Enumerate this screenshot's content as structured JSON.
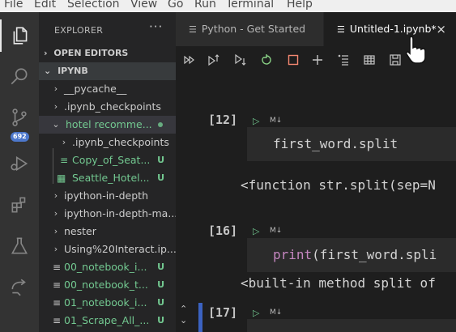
{
  "menu": [
    "File",
    "Edit",
    "Selection",
    "View",
    "Go",
    "Run",
    "Terminal",
    "Help"
  ],
  "activity_bar": {
    "items": [
      "explorer-icon",
      "search-icon",
      "source-control-icon",
      "run-debug-icon",
      "extensions-icon",
      "testing-icon",
      "remote-explorer-icon"
    ],
    "scm_badge": "692"
  },
  "sidebar": {
    "title": "EXPLORER",
    "more": "···",
    "open_editors": "OPEN EDITORS",
    "root": "IPYNB",
    "items": [
      {
        "label": "__pycache__",
        "status": ""
      },
      {
        "label": ".ipynb_checkpoints",
        "status": ""
      },
      {
        "label": "hotel recomme...",
        "status": "dot"
      },
      {
        "label": ".ipynb_checkpoints",
        "status": ""
      },
      {
        "label": "Copy_of_Seat...",
        "status": "U"
      },
      {
        "label": "Seattle_Hotel...",
        "status": "U"
      },
      {
        "label": "ipython-in-depth",
        "status": ""
      },
      {
        "label": "ipython-in-depth-ma...",
        "status": ""
      },
      {
        "label": "nester",
        "status": ""
      },
      {
        "label": "Using%20Interact.ip...",
        "status": ""
      },
      {
        "label": "00_notebook_i...",
        "status": "U"
      },
      {
        "label": "00_notebook_t...",
        "status": "U"
      },
      {
        "label": "01_notebook_i...",
        "status": "U"
      },
      {
        "label": "01_Scrape_All_...",
        "status": "U"
      }
    ]
  },
  "tabs": [
    {
      "label": "Python - Get Started"
    },
    {
      "label": "Untitled-1.ipynb*",
      "close": "×"
    }
  ],
  "cells": [
    {
      "count": "[12]",
      "md": "M↓",
      "code": "first_word.split",
      "output": "<function str.split(sep=N"
    },
    {
      "count": "[16]",
      "md": "M↓",
      "code_kw": "print",
      "code_rest": "(first_word.spli",
      "output": "<built-in method split of"
    },
    {
      "count": "[17]",
      "md": "M↓"
    }
  ],
  "colors": {
    "accent": "#3b62c1",
    "git_untracked": "#73c991",
    "badge": "#4d78cc"
  }
}
